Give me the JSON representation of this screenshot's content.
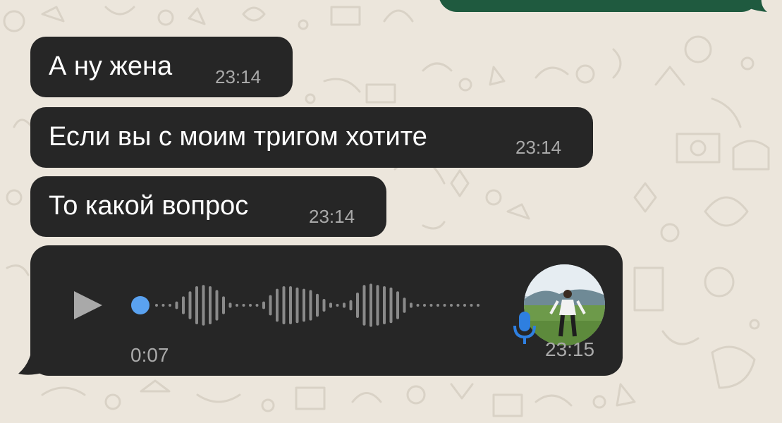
{
  "colors": {
    "wallpaper": "#ece6dc",
    "incoming_bubble": "#262626",
    "outgoing_bubble": "#1f5a3f",
    "time_text": "#a9a9a9",
    "accent_blue": "#5aa2f0",
    "mic_blue": "#2e7fe0"
  },
  "messages": [
    {
      "text": "А ну жена",
      "time": "23:14"
    },
    {
      "text": "Если вы с моим тригом хотите",
      "time": "23:14"
    },
    {
      "text": "То какой вопрос",
      "time": "23:14"
    }
  ],
  "voice_message": {
    "duration": "0:07",
    "time": "23:15",
    "progress": 0.0,
    "icons": [
      "play-icon",
      "microphone-icon",
      "avatar-photo"
    ]
  }
}
